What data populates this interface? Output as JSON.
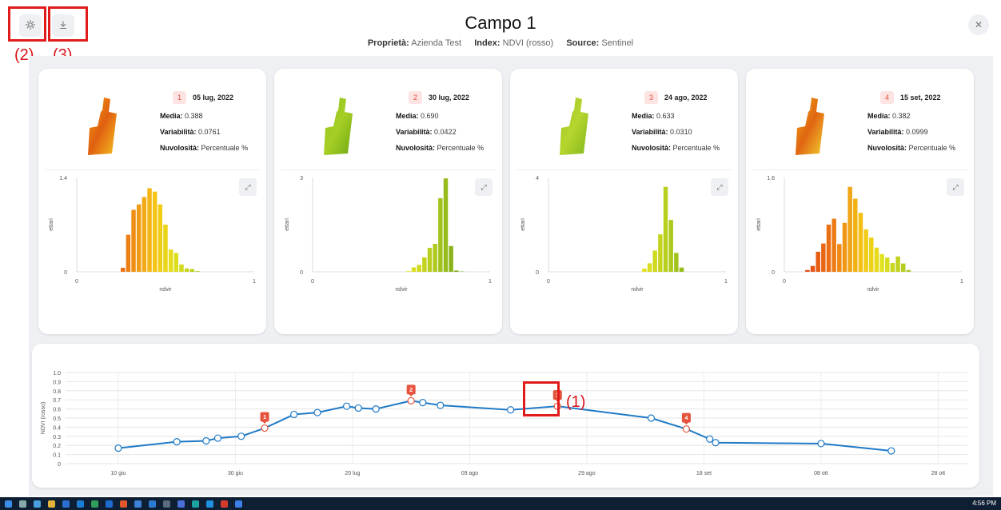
{
  "header": {
    "title": "Campo 1",
    "property_label": "Proprietà:",
    "property_value": "Azienda Test",
    "index_label": "Index:",
    "index_value": "NDVI (rosso)",
    "source_label": "Source:",
    "source_value": "Sentinel"
  },
  "annotations": {
    "a1": "(1)",
    "a2": "(2)",
    "a3": "(3)"
  },
  "labels": {
    "media": "Media:",
    "variabilita": "Variabilità:",
    "nuvolosita": "Nuvolosità:",
    "nuvolosita_value": "Percentuale %"
  },
  "cards": [
    {
      "num": "1",
      "date": "05 lug, 2022",
      "media": "0.388",
      "variabilita": "0.0761"
    },
    {
      "num": "2",
      "date": "30 lug, 2022",
      "media": "0.690",
      "variabilita": "0.0422"
    },
    {
      "num": "3",
      "date": "24 ago, 2022",
      "media": "0.633",
      "variabilita": "0.0310"
    },
    {
      "num": "4",
      "date": "15 set, 2022",
      "media": "0.382",
      "variabilita": "0.0999"
    }
  ],
  "taskbar": {
    "clock": "4:56 PM"
  },
  "chart_data": [
    {
      "type": "bar",
      "title": "",
      "xlabel": "ndvir",
      "ylabel": "ettari",
      "xlim": [
        0,
        1
      ],
      "ylim": [
        0,
        1.4
      ],
      "x_ticks": [
        "0",
        "1"
      ],
      "y_ticks": [
        "0",
        "1.4"
      ],
      "bin_centers": [
        0.26,
        0.29,
        0.32,
        0.35,
        0.38,
        0.41,
        0.44,
        0.47,
        0.5,
        0.53,
        0.56,
        0.59,
        0.62,
        0.65,
        0.68
      ],
      "values": [
        0.06,
        0.55,
        0.92,
        1.0,
        1.11,
        1.24,
        1.19,
        1.0,
        0.7,
        0.33,
        0.28,
        0.11,
        0.05,
        0.04,
        0.01
      ]
    },
    {
      "type": "bar",
      "title": "",
      "xlabel": "ndvir",
      "ylabel": "ettari",
      "xlim": [
        0,
        1
      ],
      "ylim": [
        0,
        3
      ],
      "x_ticks": [
        "0",
        "1"
      ],
      "y_ticks": [
        "0",
        "3"
      ],
      "bin_centers": [
        0.54,
        0.57,
        0.6,
        0.63,
        0.66,
        0.69,
        0.72,
        0.75,
        0.78,
        0.81,
        0.84
      ],
      "values": [
        0.02,
        0.14,
        0.22,
        0.46,
        0.76,
        0.89,
        2.34,
        2.97,
        0.82,
        0.04,
        0.01
      ]
    },
    {
      "type": "bar",
      "title": "",
      "xlabel": "ndvir",
      "ylabel": "ettari",
      "xlim": [
        0,
        1
      ],
      "ylim": [
        0,
        4
      ],
      "x_ticks": [
        "0",
        "1"
      ],
      "y_ticks": [
        "0",
        "4"
      ],
      "bin_centers": [
        0.54,
        0.57,
        0.6,
        0.63,
        0.66,
        0.69,
        0.72,
        0.75
      ],
      "values": [
        0.13,
        0.36,
        0.9,
        1.59,
        3.6,
        2.2,
        0.8,
        0.18
      ]
    },
    {
      "type": "bar",
      "title": "",
      "xlabel": "ndvir",
      "ylabel": "ettari",
      "xlim": [
        0,
        1
      ],
      "ylim": [
        0,
        1.6
      ],
      "x_ticks": [
        "0",
        "1"
      ],
      "y_ticks": [
        "0",
        "1.6"
      ],
      "bin_centers": [
        0.13,
        0.16,
        0.19,
        0.22,
        0.25,
        0.28,
        0.31,
        0.34,
        0.37,
        0.4,
        0.43,
        0.46,
        0.49,
        0.52,
        0.55,
        0.58,
        0.61,
        0.64,
        0.67,
        0.7
      ],
      "values": [
        0.03,
        0.1,
        0.34,
        0.48,
        0.8,
        0.9,
        0.47,
        0.83,
        1.44,
        1.24,
        1.0,
        0.72,
        0.58,
        0.41,
        0.3,
        0.24,
        0.15,
        0.26,
        0.14,
        0.03
      ]
    },
    {
      "type": "line",
      "title": "",
      "xlabel": "",
      "ylabel": "NDVI (rosso)",
      "ylim": [
        0,
        1.0
      ],
      "y_ticks": [
        "0",
        "0.1",
        "0.2",
        "0.3",
        "0.4",
        "0.5",
        "0.6",
        "0.7",
        "0.8",
        "0.9",
        "1.0"
      ],
      "x_ticks": [
        "10 giu",
        "30 giu",
        "20 lug",
        "09 ago",
        "29 ago",
        "18 set",
        "08 ott",
        "28 ott"
      ],
      "series": [
        {
          "dates": [
            "2022-06-10",
            "2022-06-20",
            "2022-06-25",
            "2022-06-27",
            "2022-07-01",
            "2022-07-05",
            "2022-07-10",
            "2022-07-14",
            "2022-07-19",
            "2022-07-21",
            "2022-07-24",
            "2022-07-30",
            "2022-08-01",
            "2022-08-04",
            "2022-08-16",
            "2022-08-24",
            "2022-09-09",
            "2022-09-15",
            "2022-09-19",
            "2022-09-20",
            "2022-10-08",
            "2022-10-20"
          ],
          "values": [
            0.17,
            0.24,
            0.25,
            0.28,
            0.3,
            0.39,
            0.54,
            0.56,
            0.63,
            0.61,
            0.6,
            0.69,
            0.67,
            0.64,
            0.59,
            0.63,
            0.5,
            0.38,
            0.27,
            0.23,
            0.22,
            0.14
          ],
          "markers": [
            {
              "label": "1",
              "index": 5
            },
            {
              "label": "2",
              "index": 11
            },
            {
              "label": "3",
              "index": 15
            },
            {
              "label": "4",
              "index": 17
            }
          ]
        }
      ]
    }
  ]
}
